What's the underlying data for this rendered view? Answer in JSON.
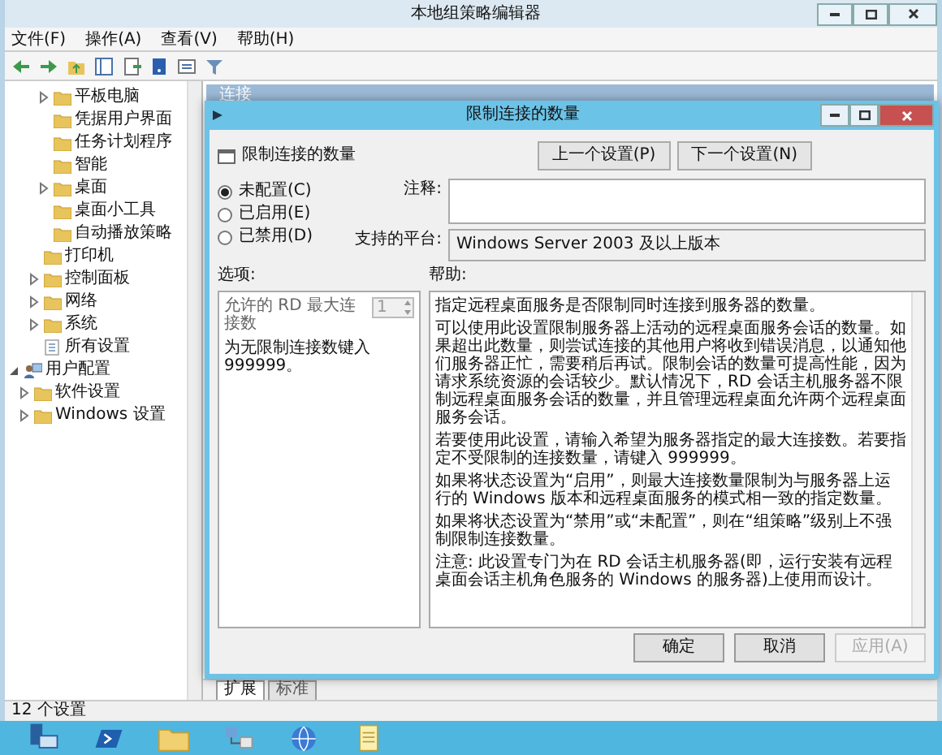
{
  "window": {
    "title": "本地组策略编辑器"
  },
  "menu": [
    "文件(F)",
    "操作(A)",
    "查看(V)",
    "帮助(H)"
  ],
  "tree": [
    {
      "children": [
        {
          "children": [
            {
              "children": [
                {
                  "label": "平板电脑",
                  "kind": "folder",
                  "expanded": false
                },
                {
                  "label": "凭据用户界面",
                  "kind": "folder"
                },
                {
                  "label": "任务计划程序",
                  "kind": "folder"
                },
                {
                  "label": "智能",
                  "kind": "folder"
                },
                {
                  "label": "桌面",
                  "kind": "folder",
                  "expanded": false
                },
                {
                  "label": "桌面小工具",
                  "kind": "folder"
                },
                {
                  "label": "自动播放策略",
                  "kind": "folder"
                }
              ]
            },
            {
              "label": "打印机",
              "kind": "folder"
            },
            {
              "label": "控制面板",
              "kind": "folder",
              "expanded": false
            },
            {
              "label": "网络",
              "kind": "folder",
              "expanded": false
            },
            {
              "label": "系统",
              "kind": "folder",
              "expanded": false
            },
            {
              "label": "所有设置",
              "kind": "settings"
            }
          ]
        }
      ]
    },
    {
      "label": "用户配置",
      "kind": "user",
      "expanded": true,
      "children": [
        {
          "label": "软件设置",
          "kind": "folder",
          "expanded": false
        },
        {
          "label": "Windows 设置",
          "kind": "folder",
          "expanded": false
        }
      ]
    }
  ],
  "details": {
    "header": "连接",
    "tabs": [
      {
        "label": "扩展",
        "selected": true
      },
      {
        "label": "标准",
        "selected": false
      }
    ]
  },
  "status_bar": "12 个设置",
  "dialog": {
    "title": "限制连接的数量",
    "heading": "限制连接的数量",
    "nav_buttons": [
      "上一个设置(P)",
      "下一个设置(N)"
    ],
    "states": [
      {
        "label": "未配置(C)",
        "selected": true
      },
      {
        "label": "已启用(E)",
        "selected": false
      },
      {
        "label": "已禁用(D)",
        "selected": false
      }
    ],
    "comment_label": "注释:",
    "platform_label": "支持的平台:",
    "platform": "Windows Server 2003 及以上版本",
    "options_label": "选项:",
    "help_label": "帮助:",
    "max_connections": {
      "label": "允许的 RD 最大连接数",
      "value": "1",
      "disabled": true
    },
    "options_note": "为无限制连接数键入 999999。",
    "help": [
      "指定远程桌面服务是否限制同时连接到服务器的数量。",
      "可以使用此设置限制服务器上活动的远程桌面服务会话的数量。如果超出此数量，则尝试连接的其他用户将收到错误消息，以通知他们服务器正忙，需要稍后再试。限制会话的数量可提高性能，因为请求系统资源的会话较少。默认情况下，RD 会话主机服务器不限制远程桌面服务会话的数量，并且管理远程桌面允许两个远程桌面服务会话。",
      "若要使用此设置，请输入希望为服务器指定的最大连接数。若要指定不受限制的连接数量，请键入 999999。",
      "如果将状态设置为“启用”，则最大连接数量限制为与服务器上运行的 Windows 版本和远程桌面服务的模式相一致的指定数量。",
      "如果将状态设置为“禁用”或“未配置”，则在“组策略”级别上不强制限制连接数量。",
      "注意: 此设置专门为在 RD 会话主机服务器(即，运行安装有远程桌面会话主机角色服务的 Windows 的服务器)上使用而设计。"
    ],
    "buttons": [
      {
        "label": "确定",
        "disabled": false
      },
      {
        "label": "取消",
        "disabled": false
      },
      {
        "label": "应用(A)",
        "disabled": true
      }
    ]
  }
}
